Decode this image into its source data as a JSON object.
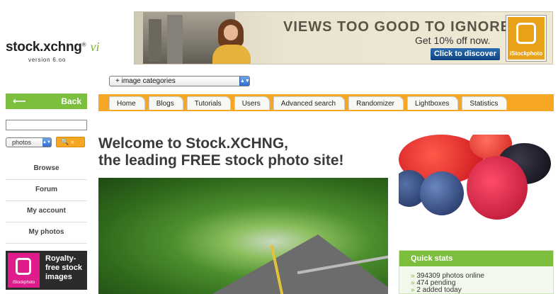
{
  "logo": {
    "name": "stock.xchng",
    "registered": "®",
    "version_mark": "vi",
    "version_text": "version 6.oo"
  },
  "banner": {
    "headline": "VIEWS TOO GOOD TO IGNORE",
    "subline": "Get 10% off now.",
    "cta": "Click to discover",
    "brand": "iStockphoto"
  },
  "category_select": {
    "value": "+ image categories"
  },
  "sidebar": {
    "back_label": "Back",
    "back_arrow": "⟵",
    "search_type": "photos",
    "search_button": "🔍 »",
    "items": [
      "Browse",
      "Forum",
      "My account",
      "My photos"
    ],
    "ad": {
      "brand": "iStockphoto",
      "text": "Royalty-free stock images"
    }
  },
  "tabs": [
    "Home",
    "Blogs",
    "Tutorials",
    "Users",
    "Advanced search",
    "Randomizer",
    "Lightboxes",
    "Statistics"
  ],
  "main": {
    "welcome_line1": "Welcome to Stock.XCHNG,",
    "welcome_line2": "the leading FREE stock photo site!"
  },
  "quick_stats": {
    "title": "Quick stats",
    "items": [
      "394309 photos online",
      "474 pending",
      "2 added today"
    ]
  },
  "colors": {
    "accent_green": "#7cbe3e",
    "accent_orange": "#f5a623"
  }
}
